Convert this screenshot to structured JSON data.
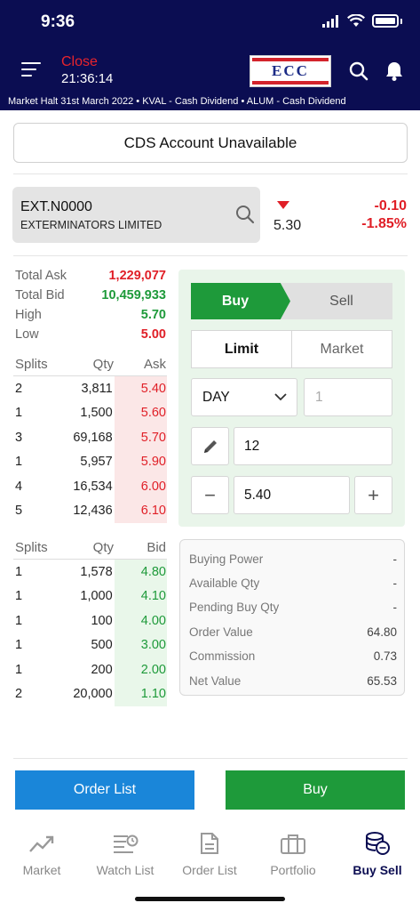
{
  "status_bar": {
    "time": "9:36"
  },
  "header": {
    "market_state": "Close",
    "market_time": "21:36:14",
    "logo_text": "ECC",
    "ticker": "Market Halt 31st March 2022   •   KVAL - Cash Dividend   •   ALUM - Cash Dividend"
  },
  "notice": "CDS Account Unavailable",
  "symbol": {
    "code": "EXT.N0000",
    "name": "EXTERMINATORS LIMITED",
    "last_price": "5.30",
    "change": "-0.10",
    "change_pct": "-1.85%"
  },
  "stats": [
    {
      "label": "Total Ask",
      "value": "1,229,077"
    },
    {
      "label": "Total Bid",
      "value": "10,459,933"
    },
    {
      "label": "High",
      "value": "5.70"
    },
    {
      "label": "Low",
      "value": "5.00"
    }
  ],
  "ask_table": {
    "headers": [
      "Splits",
      "Qty",
      "Ask"
    ],
    "rows": [
      [
        "2",
        "3,811",
        "5.40"
      ],
      [
        "1",
        "1,500",
        "5.60"
      ],
      [
        "3",
        "69,168",
        "5.70"
      ],
      [
        "1",
        "5,957",
        "5.90"
      ],
      [
        "4",
        "16,534",
        "6.00"
      ],
      [
        "5",
        "12,436",
        "6.10"
      ]
    ]
  },
  "bid_table": {
    "headers": [
      "Splits",
      "Qty",
      "Bid"
    ],
    "rows": [
      [
        "1",
        "1,578",
        "4.80"
      ],
      [
        "1",
        "1,000",
        "4.10"
      ],
      [
        "1",
        "100",
        "4.00"
      ],
      [
        "1",
        "500",
        "3.00"
      ],
      [
        "1",
        "200",
        "2.00"
      ],
      [
        "2",
        "20,000",
        "1.10"
      ]
    ]
  },
  "order_form": {
    "side_buy": "Buy",
    "side_sell": "Sell",
    "type_limit": "Limit",
    "type_market": "Market",
    "validity": "DAY",
    "quantity_placeholder": "1",
    "disclosed_qty": "12",
    "price": "5.40",
    "minus": "−",
    "plus": "+"
  },
  "summary": [
    {
      "label": "Buying Power",
      "value": "-"
    },
    {
      "label": "Available Qty",
      "value": "-"
    },
    {
      "label": "Pending Buy Qty",
      "value": "-"
    },
    {
      "label": "Order Value",
      "value": "64.80"
    },
    {
      "label": "Commission",
      "value": "0.73"
    },
    {
      "label": "Net Value",
      "value": "65.53"
    }
  ],
  "actions": {
    "order_list": "Order List",
    "buy": "Buy"
  },
  "nav": [
    {
      "label": "Market",
      "icon": "trend-up-icon"
    },
    {
      "label": "Watch List",
      "icon": "watchlist-icon"
    },
    {
      "label": "Order List",
      "icon": "document-icon"
    },
    {
      "label": "Portfolio",
      "icon": "briefcase-icon"
    },
    {
      "label": "Buy Sell",
      "icon": "coins-icon"
    }
  ],
  "colors": {
    "header_bg": "#0b0d52",
    "buy_green": "#1e9a3a",
    "sell_red": "#e01f27",
    "order_list_blue": "#1a86d9"
  }
}
